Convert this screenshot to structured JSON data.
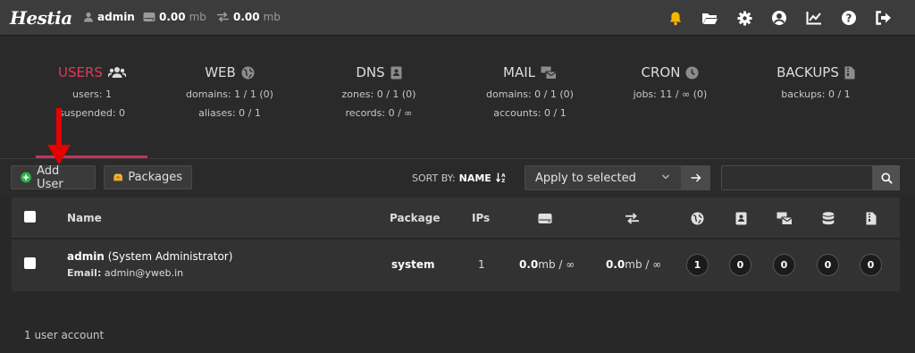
{
  "topbar": {
    "logo": "Hestia",
    "user": "admin",
    "disk_value": "0.00",
    "disk_unit": "mb",
    "bw_value": "0.00",
    "bw_unit": "mb",
    "icons": [
      "bell-icon",
      "folder-icon",
      "gear-icon",
      "user-circle-icon",
      "chart-line-icon",
      "help-icon",
      "logout-icon"
    ],
    "bell_color": "#f5b800"
  },
  "stats": [
    {
      "title": "USERS",
      "icon": "users-icon",
      "line1": "users: 1",
      "line2": "suspended: 0",
      "active": true
    },
    {
      "title": "WEB",
      "icon": "globe-icon",
      "line1": "domains: 1 / 1 (0)",
      "line2": "aliases: 0 / 1"
    },
    {
      "title": "DNS",
      "icon": "address-book-icon",
      "line1": "zones: 0 / 1 (0)",
      "line2": "records: 0 / ∞"
    },
    {
      "title": "MAIL",
      "icon": "mail-bulk-icon",
      "line1": "domains: 0 / 1 (0)",
      "line2": "accounts: 0 / 1"
    },
    {
      "title": "CRON",
      "icon": "clock-icon",
      "line1": "jobs: 11 / ∞ (0)",
      "line2": ""
    },
    {
      "title": "BACKUPS",
      "icon": "file-archive-icon",
      "line1": "backups: 0 / 1",
      "line2": ""
    }
  ],
  "accent_color": "#e0395b",
  "toolbar": {
    "add_user": "Add User",
    "packages": "Packages",
    "sort_label": "SORT BY:",
    "sort_value": "NAME",
    "bulk_action": "Apply to selected",
    "search_placeholder": ""
  },
  "table": {
    "headers": {
      "name": "Name",
      "package": "Package",
      "ips": "IPs"
    },
    "rows": [
      {
        "username": "admin",
        "fullname": "(System Administrator)",
        "email_label": "Email:",
        "email": "admin@yweb.in",
        "package": "system",
        "ips": "1",
        "disk_value": "0.0",
        "disk_rest": "mb / ∞",
        "bw_value": "0.0",
        "bw_rest": "mb / ∞",
        "web": "1",
        "dns": "0",
        "mail": "0",
        "db": "0",
        "backups": "0"
      }
    ]
  },
  "footer": "1 user account"
}
